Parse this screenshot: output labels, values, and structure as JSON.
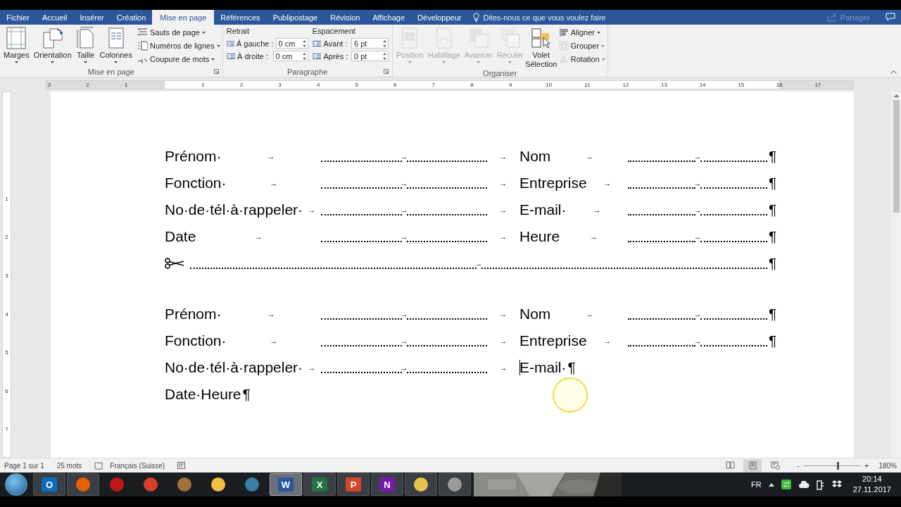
{
  "ribbon_tabs": [
    {
      "label": "Fichier",
      "selected": false
    },
    {
      "label": "Accueil",
      "selected": false
    },
    {
      "label": "Insérer",
      "selected": false
    },
    {
      "label": "Création",
      "selected": false
    },
    {
      "label": "Mise en page",
      "selected": true
    },
    {
      "label": "Références",
      "selected": false
    },
    {
      "label": "Publipostage",
      "selected": false
    },
    {
      "label": "Révision",
      "selected": false
    },
    {
      "label": "Affichage",
      "selected": false
    },
    {
      "label": "Développeur",
      "selected": false
    }
  ],
  "tell_me": {
    "placeholder": "Dites-nous ce que vous voulez faire"
  },
  "share": {
    "label": "Partager",
    "disabled": true
  },
  "ribbon_groups": [
    {
      "kind": "page_setup",
      "label": "Mise en page",
      "dialog_launcher": true,
      "large_buttons": [
        {
          "label": "Marges"
        },
        {
          "label": "Orientation"
        },
        {
          "label": "Taille"
        },
        {
          "label": "Colonnes"
        }
      ],
      "small_buttons": [
        {
          "label": "Sauts de page",
          "disabled": false
        },
        {
          "label": "Numéros de lignes",
          "disabled": false
        },
        {
          "label": "Coupure de mots",
          "disabled": false
        }
      ]
    },
    {
      "kind": "paragraph",
      "label": "Paragraphe",
      "dialog_launcher": true,
      "columns": [
        {
          "heading": "Retrait",
          "fields": [
            {
              "label": "À gauche :",
              "value": "0 cm"
            },
            {
              "label": "À droite :",
              "value": "0 cm"
            }
          ]
        },
        {
          "heading": "Espacement",
          "fields": [
            {
              "label": "Avant :",
              "value": "6 pt"
            },
            {
              "label": "Après :",
              "value": "0 pt"
            }
          ]
        }
      ]
    },
    {
      "kind": "arrange",
      "label": "Organiser",
      "dialog_launcher": false,
      "large_buttons": [
        {
          "label": "Position",
          "disabled": true
        },
        {
          "label": "Habillage",
          "disabled": true
        },
        {
          "label": "Avancer",
          "disabled": true
        },
        {
          "label": "Reculer",
          "disabled": true
        },
        {
          "label": "Volet Sélection",
          "disabled": false
        }
      ],
      "small_buttons": [
        {
          "label": "Aligner",
          "disabled": false
        },
        {
          "label": "Grouper",
          "disabled": true
        },
        {
          "label": "Rotation",
          "disabled": true
        }
      ]
    }
  ],
  "ruler": {
    "left_labels": [
      "3",
      "2",
      "1"
    ],
    "right_labels": [
      "1",
      "2",
      "3",
      "4",
      "5",
      "6",
      "7",
      "8",
      "9",
      "10",
      "11",
      "12",
      "13",
      "14",
      "15",
      "16",
      "17"
    ]
  },
  "vertical_ruler": {
    "labels": [
      "1",
      "2",
      "3",
      "4",
      "5",
      "6",
      "7"
    ]
  },
  "document": {
    "blocks": [
      {
        "rows": [
          {
            "kind": "two_fields",
            "left_label": "Prénom·",
            "left_tab": "→",
            "left_leader_tab": "→",
            "mid_tab": "→",
            "right_label": "Nom",
            "right_tab": "→",
            "right_leader_tab": "→",
            "end_mark": "¶"
          },
          {
            "kind": "two_fields",
            "left_label": "Fonction·",
            "left_tab": "→",
            "left_leader_tab": "→",
            "mid_tab": "→",
            "right_label": "Entreprise",
            "right_tab": "→",
            "right_leader_tab": "→",
            "end_mark": "¶"
          },
          {
            "kind": "two_fields",
            "left_label": "No·de·tél·à·rappeler·",
            "left_tab": "→",
            "left_leader_tab": "→",
            "mid_tab": "→",
            "right_label": "E-mail·",
            "right_tab": "→",
            "right_leader_tab": "→",
            "end_mark": "¶"
          },
          {
            "kind": "two_fields",
            "left_label": "Date",
            "left_tab": "→",
            "left_leader_tab": "→",
            "mid_tab": "→",
            "right_label": "Heure",
            "right_tab": "→",
            "right_leader_tab": "→",
            "end_mark": "¶"
          },
          {
            "kind": "cut_line",
            "leader_tab": "→",
            "end_mark": "¶"
          }
        ]
      },
      {
        "rows": [
          {
            "kind": "two_fields",
            "left_label": "Prénom·",
            "left_tab": "→",
            "left_leader_tab": "→",
            "mid_tab": "→",
            "right_label": "Nom",
            "right_tab": "→",
            "right_leader_tab": "→",
            "end_mark": "¶"
          },
          {
            "kind": "two_fields",
            "left_label": "Fonction·",
            "left_tab": "→",
            "left_leader_tab": "→",
            "mid_tab": "→",
            "right_label": "Entreprise",
            "right_tab": "→",
            "right_leader_tab": "→",
            "end_mark": "¶"
          },
          {
            "kind": "one_field",
            "left_label": "No·de·tél·à·rappeler·",
            "left_tab": "→",
            "left_leader_tab": "→",
            "mid_tab": "→",
            "right_label": "E-mail·",
            "cursor": true,
            "end_mark": "¶"
          },
          {
            "kind": "text",
            "text": "Date·Heure",
            "end_mark": "¶"
          }
        ]
      }
    ]
  },
  "status_bar": {
    "page": "Page 1 sur 1",
    "words": "25 mots",
    "language": "Français (Suisse)",
    "views": [
      {
        "selected": false
      },
      {
        "selected": true
      },
      {
        "selected": false
      }
    ],
    "zoom": {
      "minus": "-",
      "plus": "+",
      "level": 0.6,
      "reading": "180%"
    }
  },
  "taskbar": {
    "apps": [
      {
        "glyph": "O",
        "color": "#0a6ebd",
        "running": true,
        "selected": false
      },
      {
        "color": "#e66000",
        "running": true,
        "selected": false
      },
      {
        "color": "#c01818",
        "running": false,
        "selected": false
      },
      {
        "color": "#d8402a",
        "running": false,
        "selected": false
      },
      {
        "color": "#a0703a",
        "running": false,
        "selected": false
      },
      {
        "color": "#f0c040",
        "running": false,
        "selected": false
      },
      {
        "color": "#3a7ea8",
        "running": false,
        "selected": false
      },
      {
        "glyph": "W",
        "color": "#2b579a",
        "running": true,
        "selected": true
      },
      {
        "glyph": "X",
        "color": "#217346",
        "running": true,
        "selected": false
      },
      {
        "glyph": "P",
        "color": "#d24726",
        "running": true,
        "selected": false
      },
      {
        "glyph": "N",
        "color": "#7719aa",
        "running": true,
        "selected": false
      },
      {
        "color": "#e8c24a",
        "running": true,
        "selected": false
      },
      {
        "color": "#9a9a9a",
        "running": true,
        "selected": false
      }
    ],
    "language": "FR",
    "time": "20:14",
    "date": "27.11.2017"
  }
}
